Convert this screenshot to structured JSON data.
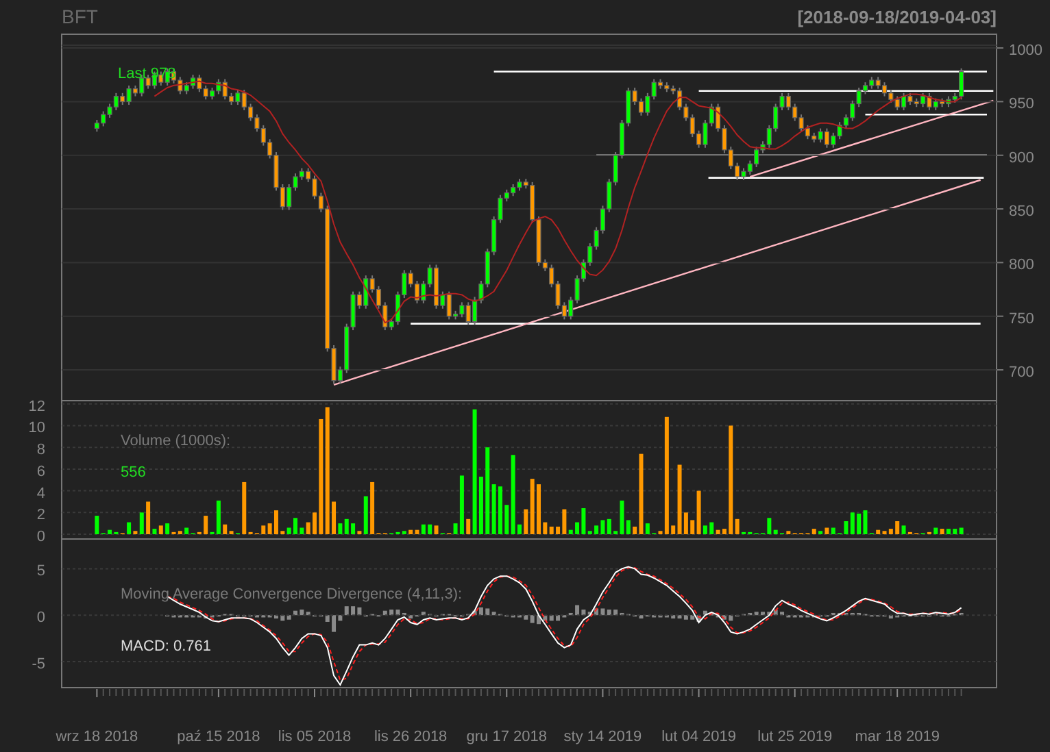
{
  "title": "BFT",
  "date_range": "[2018-09-18/2019-04-03]",
  "price_panel": {
    "last_label": "Last 978",
    "chart_data": {
      "type": "candlestick",
      "grid": true,
      "ylim": [
        671.3,
        1012.8
      ],
      "yticks": [
        700,
        750,
        800,
        850,
        900,
        950,
        1000
      ],
      "categories": [
        null,
        null,
        null,
        null,
        null,
        null,
        null,
        null,
        null,
        null,
        null,
        null,
        null,
        null,
        null,
        null,
        null,
        null,
        null,
        null,
        null,
        null,
        null,
        null,
        null,
        null,
        null,
        null,
        null,
        null,
        null,
        null,
        null,
        null,
        null,
        null,
        null,
        null,
        null,
        null,
        null,
        null,
        null,
        null,
        null,
        null,
        null,
        null,
        null,
        null,
        null,
        null,
        null,
        null,
        null,
        null,
        null,
        null,
        null,
        null,
        null,
        null,
        null,
        null,
        null,
        null,
        null,
        null,
        null,
        null,
        null,
        null,
        null,
        null,
        null,
        null,
        null,
        null,
        null,
        null,
        null,
        null,
        null,
        null,
        null,
        null,
        null,
        null,
        null,
        null,
        null,
        null,
        null,
        null,
        null,
        null,
        null,
        null,
        null,
        null,
        null,
        null,
        null,
        null,
        null,
        null,
        null,
        null,
        null,
        null,
        null,
        null,
        null,
        null,
        null,
        null,
        null,
        null,
        null,
        null,
        null,
        null,
        null,
        null,
        null,
        null,
        null,
        null,
        null,
        null,
        null,
        null,
        null,
        null,
        null,
        null,
        null,
        null,
        null,
        null,
        null,
        null,
        null,
        null,
        null,
        null
      ],
      "ohlc": [
        null,
        null,
        null,
        null,
        null,
        [
          925,
          933,
          922,
          930
        ],
        [
          930,
          941,
          927,
          938
        ],
        [
          938,
          948,
          935,
          945
        ],
        [
          945,
          958,
          942,
          955
        ],
        [
          955,
          958,
          947,
          950
        ],
        [
          950,
          965,
          947,
          962
        ],
        [
          962,
          965,
          955,
          958
        ],
        [
          958,
          975,
          955,
          972
        ],
        [
          972,
          975,
          962,
          965
        ],
        [
          965,
          978,
          962,
          975
        ],
        [
          975,
          978,
          965,
          968
        ],
        [
          968,
          981,
          965,
          978
        ],
        [
          978,
          981,
          967,
          970
        ],
        [
          970,
          973,
          957,
          960
        ],
        [
          960,
          968,
          957,
          965
        ],
        [
          965,
          975,
          962,
          972
        ],
        [
          972,
          975,
          959,
          962
        ],
        [
          962,
          965,
          952,
          955
        ],
        [
          955,
          963,
          952,
          960
        ],
        [
          960,
          971,
          957,
          968
        ],
        [
          968,
          971,
          952,
          955
        ],
        [
          955,
          958,
          947,
          950
        ],
        [
          950,
          961,
          947,
          958
        ],
        [
          958,
          961,
          942,
          945
        ],
        [
          945,
          948,
          932,
          935
        ],
        [
          935,
          938,
          922,
          925
        ],
        [
          925,
          928,
          909,
          912
        ],
        [
          912,
          915,
          897,
          900
        ],
        [
          900,
          903,
          867,
          870
        ],
        [
          870,
          873,
          849,
          852
        ],
        [
          852,
          873,
          849,
          870
        ],
        [
          870,
          883,
          867,
          880
        ],
        [
          880,
          888,
          877,
          885
        ],
        [
          885,
          888,
          875,
          878
        ],
        [
          878,
          881,
          859,
          862
        ],
        [
          862,
          865,
          847,
          850
        ],
        [
          850,
          853,
          717,
          720
        ],
        [
          720,
          723,
          687,
          690
        ],
        [
          690,
          703,
          687,
          700
        ],
        [
          700,
          743,
          697,
          740
        ],
        [
          740,
          773,
          737,
          770
        ],
        [
          770,
          773,
          757,
          760
        ],
        [
          760,
          788,
          757,
          785
        ],
        [
          785,
          788,
          772,
          775
        ],
        [
          775,
          778,
          757,
          760
        ],
        [
          760,
          763,
          737,
          740
        ],
        [
          740,
          748,
          737,
          745
        ],
        [
          745,
          773,
          742,
          770
        ],
        [
          770,
          793,
          767,
          790
        ],
        [
          790,
          793,
          777,
          780
        ],
        [
          780,
          783,
          762,
          765
        ],
        [
          765,
          783,
          762,
          780
        ],
        [
          780,
          798,
          777,
          795
        ],
        [
          795,
          798,
          757,
          760
        ],
        [
          760,
          773,
          757,
          770
        ],
        [
          770,
          773,
          747,
          750
        ],
        [
          750,
          755,
          747,
          752
        ],
        [
          752,
          763,
          749,
          760
        ],
        [
          760,
          763,
          742,
          745
        ],
        [
          745,
          768,
          742,
          765
        ],
        [
          765,
          783,
          762,
          780
        ],
        [
          780,
          813,
          777,
          810
        ],
        [
          810,
          843,
          807,
          840
        ],
        [
          840,
          863,
          837,
          860
        ],
        [
          860,
          868,
          857,
          865
        ],
        [
          865,
          873,
          862,
          870
        ],
        [
          870,
          878,
          867,
          875
        ],
        [
          875,
          878,
          869,
          872
        ],
        [
          872,
          875,
          837,
          840
        ],
        [
          840,
          843,
          797,
          800
        ],
        [
          800,
          803,
          792,
          795
        ],
        [
          795,
          798,
          777,
          780
        ],
        [
          780,
          783,
          757,
          760
        ],
        [
          760,
          763,
          747,
          750
        ],
        [
          750,
          768,
          747,
          765
        ],
        [
          765,
          788,
          762,
          785
        ],
        [
          785,
          803,
          782,
          800
        ],
        [
          800,
          818,
          797,
          815
        ],
        [
          815,
          833,
          812,
          830
        ],
        [
          830,
          853,
          827,
          850
        ],
        [
          850,
          878,
          847,
          875
        ],
        [
          875,
          903,
          872,
          900
        ],
        [
          900,
          933,
          897,
          930
        ],
        [
          930,
          963,
          927,
          960
        ],
        [
          960,
          963,
          947,
          950
        ],
        [
          950,
          953,
          937,
          940
        ],
        [
          940,
          958,
          937,
          955
        ],
        [
          955,
          971,
          952,
          968
        ],
        [
          968,
          971,
          962,
          965
        ],
        [
          965,
          968,
          959,
          962
        ],
        [
          962,
          965,
          957,
          960
        ],
        [
          960,
          963,
          942,
          945
        ],
        [
          945,
          948,
          932,
          935
        ],
        [
          935,
          938,
          917,
          920
        ],
        [
          920,
          923,
          907,
          910
        ],
        [
          910,
          933,
          907,
          930
        ],
        [
          930,
          948,
          927,
          945
        ],
        [
          945,
          948,
          922,
          925
        ],
        [
          925,
          928,
          902,
          905
        ],
        [
          905,
          908,
          887,
          890
        ],
        [
          890,
          893,
          877,
          880
        ],
        [
          880,
          888,
          877,
          885
        ],
        [
          885,
          895,
          882,
          892
        ],
        [
          892,
          908,
          889,
          905
        ],
        [
          905,
          913,
          902,
          910
        ],
        [
          910,
          928,
          907,
          925
        ],
        [
          925,
          948,
          922,
          945
        ],
        [
          945,
          958,
          942,
          955
        ],
        [
          955,
          958,
          942,
          945
        ],
        [
          945,
          948,
          932,
          935
        ],
        [
          935,
          938,
          922,
          925
        ],
        [
          925,
          928,
          915,
          918
        ],
        [
          918,
          921,
          912,
          915
        ],
        [
          915,
          925,
          912,
          922
        ],
        [
          922,
          925,
          907,
          910
        ],
        [
          910,
          921,
          907,
          918
        ],
        [
          918,
          931,
          915,
          928
        ],
        [
          928,
          938,
          925,
          935
        ],
        [
          935,
          951,
          932,
          948
        ],
        [
          948,
          963,
          945,
          960
        ],
        [
          960,
          968,
          957,
          965
        ],
        [
          965,
          973,
          962,
          970
        ],
        [
          970,
          973,
          962,
          965
        ],
        [
          965,
          968,
          955,
          958
        ],
        [
          958,
          961,
          949,
          952
        ],
        [
          952,
          955,
          942,
          945
        ],
        [
          945,
          958,
          942,
          955
        ],
        [
          955,
          958,
          947,
          950
        ],
        [
          950,
          953,
          945,
          948
        ],
        [
          948,
          958,
          945,
          955
        ],
        [
          955,
          958,
          942,
          945
        ],
        [
          945,
          953,
          942,
          950
        ],
        [
          950,
          953,
          945,
          948
        ],
        [
          948,
          955,
          945,
          952
        ],
        [
          952,
          958,
          949,
          955
        ],
        [
          955,
          981,
          952,
          978
        ],
        null,
        null,
        null,
        null,
        null
      ],
      "series": [
        {
          "type": "line",
          "color": "#b22222",
          "values": [
            null,
            null,
            null,
            null,
            null,
            null,
            null,
            null,
            null,
            null,
            null,
            null,
            null,
            null,
            955,
            959,
            963,
            965,
            966,
            967,
            968,
            969,
            967,
            967,
            966,
            965,
            962,
            961,
            959,
            956,
            951,
            946,
            941,
            932,
            920,
            912,
            905,
            897,
            891,
            883,
            876,
            857,
            836,
            819,
            808,
            798,
            786,
            776,
            765,
            755,
            744,
            747,
            755,
            764,
            768,
            767,
            769,
            770,
            769,
            770,
            771,
            771,
            770,
            766,
            764,
            766,
            769,
            773,
            783,
            793,
            805,
            817,
            828,
            838,
            841,
            843,
            840,
            832,
            821,
            811,
            802,
            795,
            789,
            788,
            793,
            801,
            813,
            830,
            851,
            870,
            885,
            901,
            916,
            929,
            941,
            949,
            954,
            954,
            950,
            946,
            945,
            944,
            940,
            934,
            927,
            919,
            913,
            908,
            907,
            907,
            906,
            906,
            909,
            913,
            918,
            922,
            926,
            928,
            930,
            930,
            929,
            927,
            925,
            925,
            928,
            932,
            937,
            942,
            946,
            950,
            953,
            955,
            957,
            957,
            956,
            954,
            952,
            951,
            950,
            950,
            954,
            null,
            null,
            null,
            null,
            null
          ]
        }
      ]
    }
  },
  "volume_panel": {
    "last_value": "556",
    "chart_data": {
      "type": "bar",
      "grid": true,
      "ylim": [
        -0.44,
        12.3
      ],
      "yticks": [
        0,
        2,
        4,
        6,
        8,
        10,
        12
      ],
      "categories": [
        null,
        null,
        null,
        null,
        null,
        null,
        null,
        null,
        null,
        null,
        null,
        null,
        null,
        null,
        null,
        null,
        null,
        null,
        null,
        null,
        null,
        null,
        null,
        null,
        null,
        null,
        null,
        null,
        null,
        null,
        null,
        null,
        null,
        null,
        null,
        null,
        null,
        null,
        null,
        null,
        null,
        null,
        null,
        null,
        null,
        null,
        null,
        null,
        null,
        null,
        null,
        null,
        null,
        null,
        null,
        null,
        null,
        null,
        null,
        null,
        null,
        null,
        null,
        null,
        null,
        null,
        null,
        null,
        null,
        null,
        null,
        null,
        null,
        null,
        null,
        null,
        null,
        null,
        null,
        null,
        null,
        null,
        null,
        null,
        null,
        null,
        null,
        null,
        null,
        null,
        null,
        null,
        null,
        null,
        null,
        null,
        null,
        null,
        null,
        null,
        null,
        null,
        null,
        null,
        null,
        null,
        null,
        null,
        null,
        null,
        null,
        null,
        null,
        null,
        null,
        null,
        null,
        null,
        null,
        null,
        null,
        null,
        null,
        null,
        null,
        null,
        null,
        null,
        null,
        null,
        null,
        null,
        null,
        null,
        null,
        null,
        null,
        null,
        null,
        null,
        null,
        null,
        null,
        null,
        null,
        null
      ],
      "series": [
        {
          "name": "Volume (1000s):",
          "color": "#00ff00",
          "values": [
            null,
            null,
            null,
            null,
            null,
            1.7,
            0.1,
            0.4,
            0.2,
            null,
            1.1,
            null,
            2.0,
            null,
            0.5,
            null,
            1.0,
            null,
            null,
            0.6,
            0.1,
            null,
            null,
            0.2,
            3.1,
            null,
            null,
            0.1,
            null,
            null,
            null,
            null,
            null,
            null,
            null,
            0.6,
            1.5,
            0.6,
            null,
            null,
            null,
            null,
            null,
            1.0,
            1.4,
            1.0,
            null,
            3.5,
            null,
            null,
            null,
            0.1,
            0.2,
            0.3,
            null,
            null,
            0.9,
            0.9,
            null,
            0.1,
            null,
            1.0,
            5.4,
            null,
            11.5,
            5.3,
            8.0,
            4.6,
            4.4,
            2.7,
            7.3,
            0.9,
            null,
            null,
            null,
            null,
            null,
            null,
            null,
            0.4,
            1.1,
            2.4,
            0.3,
            0.8,
            1.3,
            1.4,
            0.3,
            3.1,
            1.3,
            null,
            null,
            1.0,
            0.1,
            null,
            null,
            null,
            null,
            null,
            null,
            null,
            0.8,
            1.1,
            null,
            null,
            null,
            null,
            0.2,
            0.2,
            0.1,
            0.1,
            1.5,
            0.4,
            0.1,
            null,
            null,
            null,
            null,
            null,
            0.3,
            null,
            0.6,
            0.1,
            1.2,
            2.0,
            1.9,
            2.2,
            0.1,
            null,
            null,
            null,
            null,
            0.8,
            null,
            null,
            0.1,
            null,
            0.6,
            null,
            0.5,
            0.5,
            0.6,
            null,
            null,
            null,
            null,
            null
          ]
        },
        {
          "color": "#ff9900",
          "values": [
            null,
            null,
            null,
            null,
            null,
            null,
            null,
            null,
            null,
            0.1,
            null,
            0.3,
            null,
            3.0,
            null,
            0.8,
            null,
            0.2,
            0.3,
            null,
            null,
            0.2,
            1.7,
            null,
            null,
            0.9,
            0.3,
            null,
            4.8,
            0.2,
            0.1,
            0.8,
            1.0,
            2.2,
            0.3,
            null,
            null,
            null,
            1.1,
            2.0,
            10.6,
            11.7,
            3.0,
            null,
            null,
            null,
            0.3,
            null,
            4.8,
            0.1,
            0.1,
            null,
            null,
            null,
            0.4,
            0.4,
            null,
            null,
            0.8,
            null,
            0.1,
            null,
            null,
            1.4,
            null,
            null,
            null,
            null,
            null,
            null,
            null,
            null,
            2.3,
            5.1,
            4.6,
            1.1,
            0.7,
            0.7,
            2.3,
            null,
            null,
            null,
            null,
            null,
            null,
            null,
            null,
            null,
            null,
            0.7,
            7.4,
            null,
            null,
            0.3,
            10.8,
            0.8,
            6.4,
            2.0,
            1.3,
            4.0,
            null,
            null,
            0.4,
            0.5,
            10.0,
            1.4,
            null,
            null,
            null,
            null,
            null,
            null,
            null,
            0.3,
            0.1,
            0.1,
            0.1,
            0.5,
            null,
            0.6,
            null,
            null,
            null,
            null,
            null,
            null,
            null,
            0.4,
            0.3,
            0.5,
            1.2,
            null,
            0.2,
            0.1,
            null,
            0.2,
            null,
            0.5,
            null,
            null,
            null,
            null,
            null,
            null,
            null,
            null
          ]
        }
      ]
    }
  },
  "macd_panel": {
    "macd_label": "MACD: 0.761",
    "chart_data": {
      "type": "line",
      "grid": true,
      "ylim": [
        -7.8,
        8.2
      ],
      "yticks": [
        -5,
        0,
        5
      ],
      "categories": [
        null,
        null,
        null,
        null,
        null,
        "wrz 18 2018",
        null,
        null,
        null,
        null,
        null,
        null,
        null,
        null,
        null,
        null,
        null,
        null,
        null,
        null,
        null,
        null,
        null,
        null,
        "paź 15 2018",
        null,
        null,
        null,
        null,
        null,
        null,
        null,
        null,
        null,
        null,
        null,
        null,
        null,
        null,
        "lis 05 2018",
        null,
        null,
        null,
        null,
        null,
        null,
        null,
        null,
        null,
        null,
        null,
        null,
        null,
        null,
        "lis 26 2018",
        null,
        null,
        null,
        null,
        null,
        null,
        null,
        null,
        null,
        null,
        null,
        null,
        null,
        null,
        "gru 17 2018",
        null,
        null,
        null,
        null,
        null,
        null,
        null,
        null,
        null,
        null,
        null,
        null,
        null,
        null,
        "sty 14 2019",
        null,
        null,
        null,
        null,
        null,
        null,
        null,
        null,
        null,
        null,
        null,
        null,
        null,
        null,
        "lut 04 2019",
        null,
        null,
        null,
        null,
        null,
        null,
        null,
        null,
        null,
        null,
        null,
        null,
        null,
        null,
        "lut 25 2019",
        null,
        null,
        null,
        null,
        null,
        null,
        null,
        null,
        null,
        null,
        null,
        null,
        null,
        null,
        null,
        "mar 18 2019",
        null,
        null,
        null,
        null,
        null,
        null,
        null,
        null,
        null,
        null,
        null,
        null,
        null,
        null,
        null
      ],
      "series": [
        {
          "name": "Moving Average Convergence Divergence (4,11,3):",
          "color": "#ffffff",
          "values": [
            null,
            null,
            null,
            null,
            null,
            null,
            null,
            null,
            null,
            null,
            null,
            null,
            null,
            null,
            null,
            null,
            2,
            1.6,
            1.2,
            0.9,
            0.6,
            0.3,
            -0.2,
            -0.6,
            -0.7,
            -0.5,
            -0.3,
            -0.3,
            -0.3,
            -0.4,
            -0.8,
            -1.3,
            -1.8,
            -2.5,
            -3.5,
            -4.3,
            -3.5,
            -2.5,
            -2.0,
            -2.0,
            -2.2,
            -3.5,
            -6.5,
            -7.5,
            -6,
            -4.5,
            -3.2,
            -3.2,
            -3.0,
            -3.2,
            -2.5,
            -1.5,
            -0.5,
            -0.2,
            -0.8,
            -1,
            -0.5,
            -0.3,
            -0.5,
            -0.4,
            -0.3,
            -0.3,
            -0.5,
            -0.3,
            0.5,
            2,
            3.2,
            3.9,
            4.2,
            4.2,
            3.9,
            3.5,
            2.8,
            1.5,
            0,
            -1,
            -2,
            -3,
            -3.5,
            -3.2,
            -1.5,
            -0.5,
            0,
            1.2,
            2.5,
            3.5,
            4.6,
            5.0,
            5.2,
            5.0,
            4.4,
            4.3,
            4.0,
            3.6,
            3.2,
            2.6,
            2.0,
            1.3,
            0.5,
            -0.8,
            0,
            0.3,
            0,
            -0.8,
            -1.8,
            -2,
            -1.8,
            -1.5,
            -1,
            -0.5,
            0,
            1.0,
            1.6,
            1.2,
            0.9,
            0.5,
            0.2,
            -0.1,
            -0.4,
            -0.6,
            -0.3,
            0.1,
            0.5,
            1,
            1.5,
            1.8,
            1.6,
            1.4,
            1.2,
            0.6,
            0.2,
            0.2,
            0,
            0.1,
            0.2,
            0.1,
            0.3,
            0.2,
            0.1,
            0.3,
            0.8,
            null,
            null,
            null,
            null,
            null
          ]
        },
        {
          "color": "#ff2020",
          "line_style": "dashed",
          "values": [
            null,
            null,
            null,
            null,
            null,
            null,
            null,
            null,
            null,
            null,
            null,
            null,
            null,
            null,
            null,
            null,
            2,
            1.8,
            1.4,
            1.1,
            0.8,
            0.5,
            0.1,
            -0.4,
            -0.7,
            -0.6,
            -0.4,
            -0.3,
            -0.3,
            -0.4,
            -0.6,
            -1.1,
            -1.6,
            -2.2,
            -3,
            -3.9,
            -3.9,
            -3,
            -2.3,
            -2,
            -2.1,
            -2.9,
            -5,
            -7,
            -6.8,
            -5.3,
            -3.9,
            -3.2,
            -3.1,
            -3.1,
            -2.9,
            -2,
            -1,
            -0.4,
            -0.5,
            -0.9,
            -0.8,
            -0.4,
            -0.4,
            -0.5,
            -0.4,
            -0.3,
            -0.4,
            -0.4,
            0.1,
            1.3,
            2.6,
            3.6,
            4.1,
            4.2,
            4.1,
            3.7,
            3.2,
            2.2,
            0.8,
            -0.5,
            -1.5,
            -2.5,
            -3.3,
            -3.4,
            -2.4,
            -1,
            -0.3,
            0.6,
            1.9,
            3,
            4.1,
            4.8,
            5.1,
            5.1,
            4.7,
            4.4,
            4.2,
            3.8,
            3.4,
            2.9,
            2.3,
            1.7,
            0.9,
            -0.2,
            -0.4,
            0.2,
            0.2,
            -0.4,
            -1.3,
            -1.9,
            -1.9,
            -1.7,
            -1.3,
            -0.8,
            -0.3,
            0.5,
            1.3,
            1.4,
            1.1,
            0.7,
            0.4,
            0.1,
            -0.3,
            -0.5,
            -0.5,
            -0.1,
            0.3,
            0.8,
            1.3,
            1.7,
            1.7,
            1.5,
            1.3,
            0.9,
            0.4,
            0.2,
            0.1,
            0.1,
            0.2,
            0.2,
            0.2,
            0.3,
            0.2,
            0.2,
            0.6,
            null,
            null,
            null,
            null,
            null
          ]
        }
      ]
    }
  }
}
